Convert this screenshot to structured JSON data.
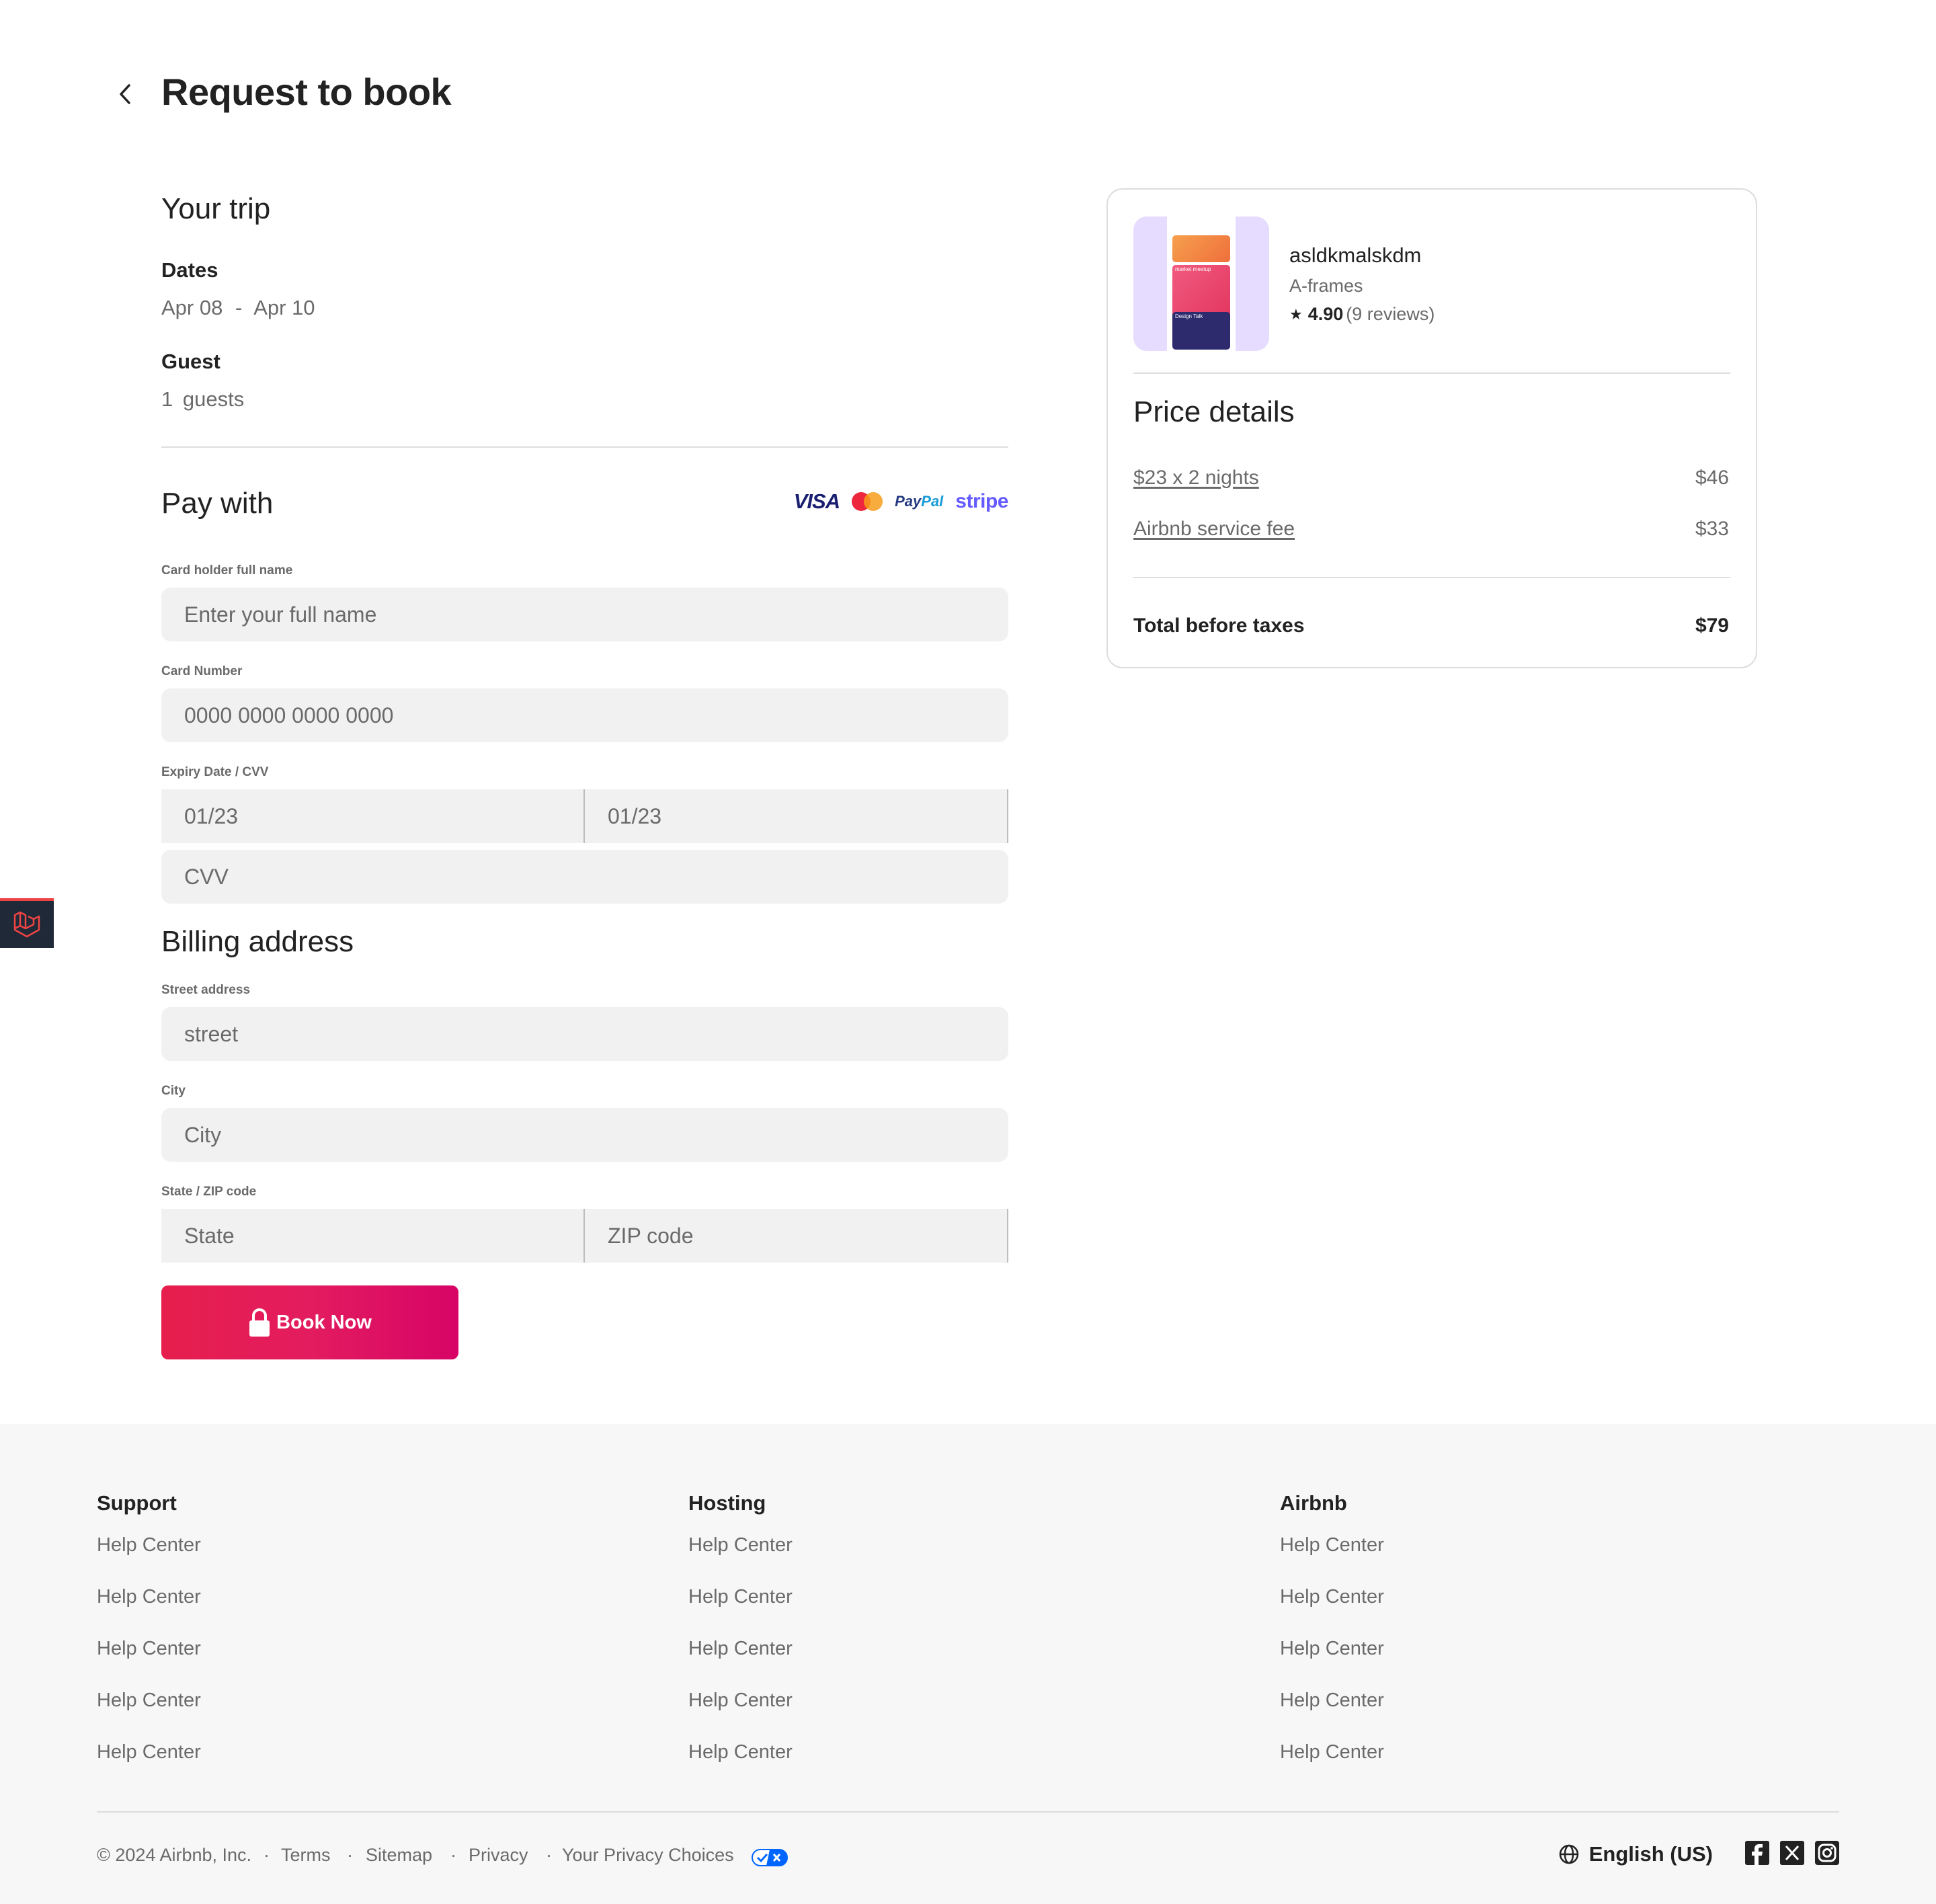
{
  "header": {
    "title": "Request to book",
    "back_icon": "chevron-left-icon"
  },
  "trip": {
    "heading": "Your trip",
    "dates_label": "Dates",
    "dates_start": "Apr 08",
    "dates_sep": "-",
    "dates_end": "Apr 10",
    "guest_label": "Guest",
    "guest_count": "1",
    "guest_unit": "guests"
  },
  "payment": {
    "heading": "Pay with",
    "logos": {
      "visa": "VISA",
      "paypal_a": "Pay",
      "paypal_b": "Pal",
      "stripe": "stripe"
    },
    "cardholder_label": "Card holder full name",
    "cardholder_placeholder": "Enter your full name",
    "card_number_label": "Card Number",
    "card_number_placeholder": "0000 0000 0000 0000",
    "expiry_label": "Expiry Date / CVV",
    "expiry_month_placeholder": "01/23",
    "expiry_year_placeholder": "01/23",
    "cvv_placeholder": "CVV"
  },
  "billing": {
    "heading": "Billing address",
    "street_label": "Street address",
    "street_placeholder": "street",
    "city_label": "City",
    "city_placeholder": "City",
    "state_zip_label": "State / ZIP code",
    "state_placeholder": "State",
    "zip_placeholder": "ZIP code"
  },
  "book_button": {
    "label": "Book Now",
    "icon": "lock-icon"
  },
  "listing": {
    "name": "asldkmalskdm",
    "type": "A-frames",
    "rating": "4.90",
    "reviews": "(9 reviews)",
    "thumb_cards": [
      "market meetup",
      "Design Talk"
    ]
  },
  "price": {
    "heading": "Price details",
    "rows": [
      {
        "label": "$23 x 2 nights",
        "amount": "$46"
      },
      {
        "label": "Airbnb service fee",
        "amount": "$33"
      }
    ],
    "total_label": "Total before taxes",
    "total_amount": "$79"
  },
  "footer": {
    "columns": [
      {
        "title": "Support",
        "links": [
          "Help Center",
          "Help Center",
          "Help Center",
          "Help Center",
          "Help Center"
        ]
      },
      {
        "title": "Hosting",
        "links": [
          "Help Center",
          "Help Center",
          "Help Center",
          "Help Center",
          "Help Center"
        ]
      },
      {
        "title": "Airbnb",
        "links": [
          "Help Center",
          "Help Center",
          "Help Center",
          "Help Center",
          "Help Center"
        ]
      }
    ],
    "copyright": "© 2024 Airbnb, Inc.",
    "bottom_links": [
      "Terms",
      "Sitemap",
      "Privacy",
      "Your Privacy Choices"
    ],
    "separator": "·",
    "language": "English (US)",
    "social_icons": [
      "facebook-icon",
      "x-icon",
      "instagram-icon"
    ]
  },
  "colors": {
    "accent": "#e31c5f",
    "text": "#222222",
    "muted": "#6a6a6a",
    "input_bg": "#f1f1f1",
    "footer_bg": "#f7f7f7"
  }
}
